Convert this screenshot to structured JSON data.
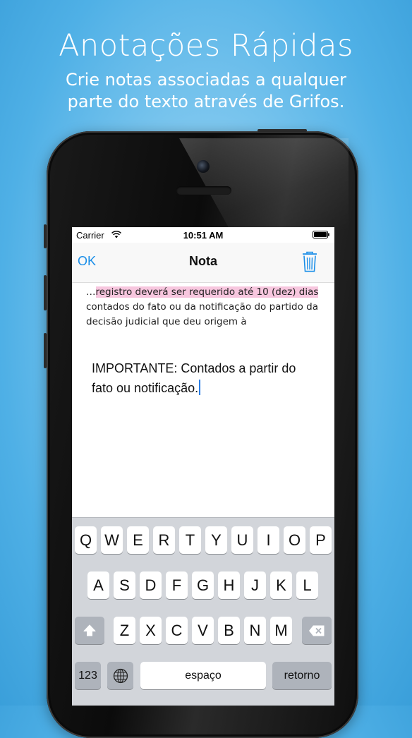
{
  "promo": {
    "title": "Anotações Rápidas",
    "subtitle_line1": "Crie notas associadas a qualquer",
    "subtitle_line2": "parte do texto através de Grifos."
  },
  "status_bar": {
    "carrier": "Carrier",
    "time": "10:51 AM",
    "wifi_icon": "wifi-icon",
    "battery_icon": "battery-icon"
  },
  "nav": {
    "ok_label": "OK",
    "title": "Nota",
    "delete_icon": "trash-icon",
    "accent": "#1a8ee8"
  },
  "quote": {
    "prefix": "…",
    "highlight": "registro deverá ser requerido até 10 (dez) dias",
    "rest": " contados do fato ou da notificação do partido da decisão judicial que deu origem à",
    "highlight_color": "#f7c6de"
  },
  "note": {
    "text": "IMPORTANTE: Contados a partir do fato ou notificação."
  },
  "keyboard": {
    "row1": [
      "Q",
      "W",
      "E",
      "R",
      "T",
      "Y",
      "U",
      "I",
      "O",
      "P"
    ],
    "row2": [
      "A",
      "S",
      "D",
      "F",
      "G",
      "H",
      "J",
      "K",
      "L"
    ],
    "row3": [
      "Z",
      "X",
      "C",
      "V",
      "B",
      "N",
      "M"
    ],
    "numbers_label": "123",
    "space_label": "espaço",
    "return_label": "retorno",
    "shift_icon": "shift-icon",
    "backspace_icon": "backspace-icon",
    "globe_icon": "globe-icon"
  }
}
